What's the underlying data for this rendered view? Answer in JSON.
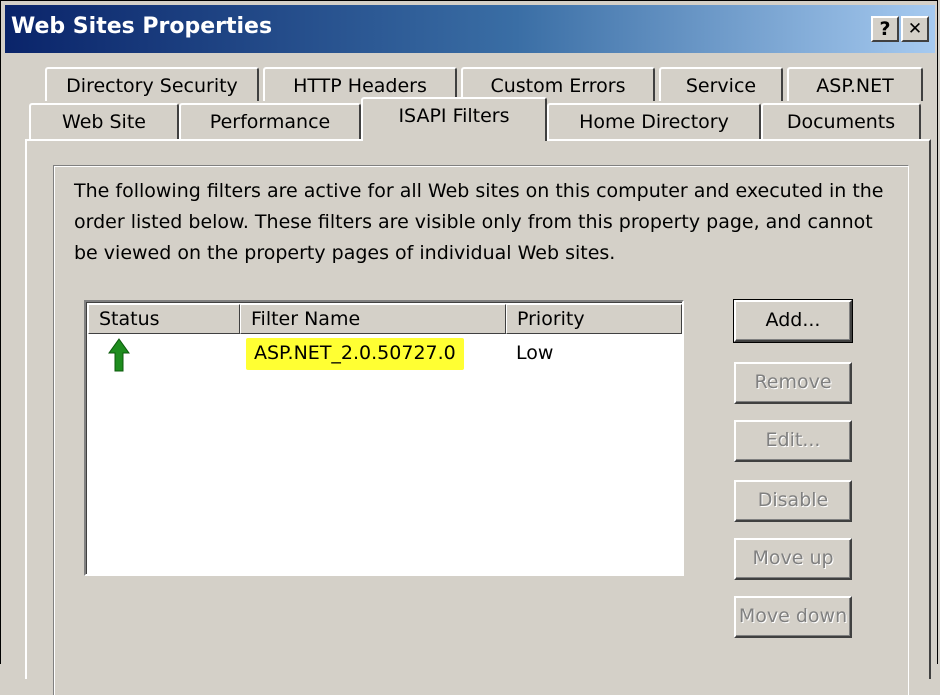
{
  "window": {
    "title": "Web Sites Properties",
    "help_label": "?",
    "close_label": "✕"
  },
  "tabs_row1": [
    {
      "label": "Directory Security"
    },
    {
      "label": "HTTP Headers"
    },
    {
      "label": "Custom Errors"
    },
    {
      "label": "Service"
    },
    {
      "label": "ASP.NET"
    }
  ],
  "tabs_row2": [
    {
      "label": "Web Site"
    },
    {
      "label": "Performance"
    },
    {
      "label": "ISAPI Filters",
      "active": true
    },
    {
      "label": "Home Directory"
    },
    {
      "label": "Documents"
    }
  ],
  "panel": {
    "description": "The following filters are active for all Web sites on this computer and executed in the order listed below. These filters are visible only from this property page, and cannot be viewed on the property pages of individual Web sites.",
    "list": {
      "columns": [
        "Status",
        "Filter Name",
        "Priority"
      ],
      "rows": [
        {
          "status_icon": "green-up-arrow-icon",
          "filter_name": "ASP.NET_2.0.50727.0",
          "priority": "Low"
        }
      ]
    },
    "buttons": {
      "add": "Add...",
      "remove": "Remove",
      "edit": "Edit...",
      "disable": "Disable",
      "move_up": "Move up",
      "move_down": "Move down"
    }
  },
  "colors": {
    "title_gradient_start": "#0a246a",
    "highlight": "#ffff33",
    "status_arrow": "#1e8c1e"
  }
}
